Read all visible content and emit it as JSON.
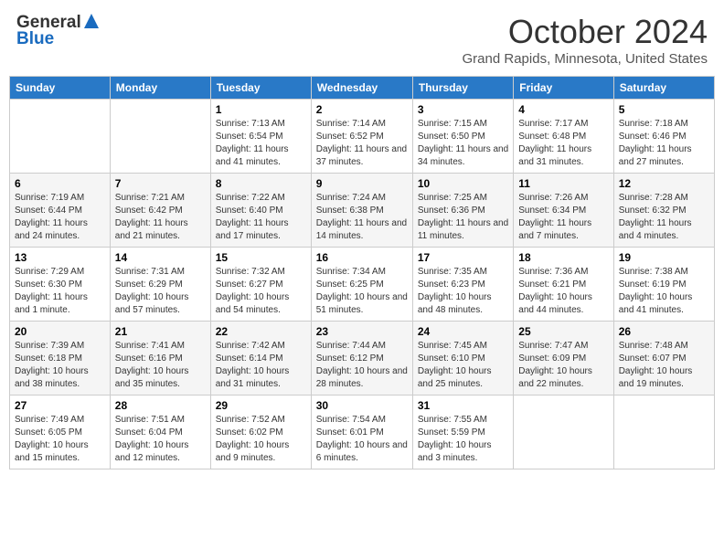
{
  "header": {
    "logo_general": "General",
    "logo_blue": "Blue",
    "title": "October 2024",
    "location": "Grand Rapids, Minnesota, United States"
  },
  "days_of_week": [
    "Sunday",
    "Monday",
    "Tuesday",
    "Wednesday",
    "Thursday",
    "Friday",
    "Saturday"
  ],
  "weeks": [
    [
      {
        "day": "",
        "sunrise": "",
        "sunset": "",
        "daylight": ""
      },
      {
        "day": "",
        "sunrise": "",
        "sunset": "",
        "daylight": ""
      },
      {
        "day": "1",
        "sunrise": "Sunrise: 7:13 AM",
        "sunset": "Sunset: 6:54 PM",
        "daylight": "Daylight: 11 hours and 41 minutes."
      },
      {
        "day": "2",
        "sunrise": "Sunrise: 7:14 AM",
        "sunset": "Sunset: 6:52 PM",
        "daylight": "Daylight: 11 hours and 37 minutes."
      },
      {
        "day": "3",
        "sunrise": "Sunrise: 7:15 AM",
        "sunset": "Sunset: 6:50 PM",
        "daylight": "Daylight: 11 hours and 34 minutes."
      },
      {
        "day": "4",
        "sunrise": "Sunrise: 7:17 AM",
        "sunset": "Sunset: 6:48 PM",
        "daylight": "Daylight: 11 hours and 31 minutes."
      },
      {
        "day": "5",
        "sunrise": "Sunrise: 7:18 AM",
        "sunset": "Sunset: 6:46 PM",
        "daylight": "Daylight: 11 hours and 27 minutes."
      }
    ],
    [
      {
        "day": "6",
        "sunrise": "Sunrise: 7:19 AM",
        "sunset": "Sunset: 6:44 PM",
        "daylight": "Daylight: 11 hours and 24 minutes."
      },
      {
        "day": "7",
        "sunrise": "Sunrise: 7:21 AM",
        "sunset": "Sunset: 6:42 PM",
        "daylight": "Daylight: 11 hours and 21 minutes."
      },
      {
        "day": "8",
        "sunrise": "Sunrise: 7:22 AM",
        "sunset": "Sunset: 6:40 PM",
        "daylight": "Daylight: 11 hours and 17 minutes."
      },
      {
        "day": "9",
        "sunrise": "Sunrise: 7:24 AM",
        "sunset": "Sunset: 6:38 PM",
        "daylight": "Daylight: 11 hours and 14 minutes."
      },
      {
        "day": "10",
        "sunrise": "Sunrise: 7:25 AM",
        "sunset": "Sunset: 6:36 PM",
        "daylight": "Daylight: 11 hours and 11 minutes."
      },
      {
        "day": "11",
        "sunrise": "Sunrise: 7:26 AM",
        "sunset": "Sunset: 6:34 PM",
        "daylight": "Daylight: 11 hours and 7 minutes."
      },
      {
        "day": "12",
        "sunrise": "Sunrise: 7:28 AM",
        "sunset": "Sunset: 6:32 PM",
        "daylight": "Daylight: 11 hours and 4 minutes."
      }
    ],
    [
      {
        "day": "13",
        "sunrise": "Sunrise: 7:29 AM",
        "sunset": "Sunset: 6:30 PM",
        "daylight": "Daylight: 11 hours and 1 minute."
      },
      {
        "day": "14",
        "sunrise": "Sunrise: 7:31 AM",
        "sunset": "Sunset: 6:29 PM",
        "daylight": "Daylight: 10 hours and 57 minutes."
      },
      {
        "day": "15",
        "sunrise": "Sunrise: 7:32 AM",
        "sunset": "Sunset: 6:27 PM",
        "daylight": "Daylight: 10 hours and 54 minutes."
      },
      {
        "day": "16",
        "sunrise": "Sunrise: 7:34 AM",
        "sunset": "Sunset: 6:25 PM",
        "daylight": "Daylight: 10 hours and 51 minutes."
      },
      {
        "day": "17",
        "sunrise": "Sunrise: 7:35 AM",
        "sunset": "Sunset: 6:23 PM",
        "daylight": "Daylight: 10 hours and 48 minutes."
      },
      {
        "day": "18",
        "sunrise": "Sunrise: 7:36 AM",
        "sunset": "Sunset: 6:21 PM",
        "daylight": "Daylight: 10 hours and 44 minutes."
      },
      {
        "day": "19",
        "sunrise": "Sunrise: 7:38 AM",
        "sunset": "Sunset: 6:19 PM",
        "daylight": "Daylight: 10 hours and 41 minutes."
      }
    ],
    [
      {
        "day": "20",
        "sunrise": "Sunrise: 7:39 AM",
        "sunset": "Sunset: 6:18 PM",
        "daylight": "Daylight: 10 hours and 38 minutes."
      },
      {
        "day": "21",
        "sunrise": "Sunrise: 7:41 AM",
        "sunset": "Sunset: 6:16 PM",
        "daylight": "Daylight: 10 hours and 35 minutes."
      },
      {
        "day": "22",
        "sunrise": "Sunrise: 7:42 AM",
        "sunset": "Sunset: 6:14 PM",
        "daylight": "Daylight: 10 hours and 31 minutes."
      },
      {
        "day": "23",
        "sunrise": "Sunrise: 7:44 AM",
        "sunset": "Sunset: 6:12 PM",
        "daylight": "Daylight: 10 hours and 28 minutes."
      },
      {
        "day": "24",
        "sunrise": "Sunrise: 7:45 AM",
        "sunset": "Sunset: 6:10 PM",
        "daylight": "Daylight: 10 hours and 25 minutes."
      },
      {
        "day": "25",
        "sunrise": "Sunrise: 7:47 AM",
        "sunset": "Sunset: 6:09 PM",
        "daylight": "Daylight: 10 hours and 22 minutes."
      },
      {
        "day": "26",
        "sunrise": "Sunrise: 7:48 AM",
        "sunset": "Sunset: 6:07 PM",
        "daylight": "Daylight: 10 hours and 19 minutes."
      }
    ],
    [
      {
        "day": "27",
        "sunrise": "Sunrise: 7:49 AM",
        "sunset": "Sunset: 6:05 PM",
        "daylight": "Daylight: 10 hours and 15 minutes."
      },
      {
        "day": "28",
        "sunrise": "Sunrise: 7:51 AM",
        "sunset": "Sunset: 6:04 PM",
        "daylight": "Daylight: 10 hours and 12 minutes."
      },
      {
        "day": "29",
        "sunrise": "Sunrise: 7:52 AM",
        "sunset": "Sunset: 6:02 PM",
        "daylight": "Daylight: 10 hours and 9 minutes."
      },
      {
        "day": "30",
        "sunrise": "Sunrise: 7:54 AM",
        "sunset": "Sunset: 6:01 PM",
        "daylight": "Daylight: 10 hours and 6 minutes."
      },
      {
        "day": "31",
        "sunrise": "Sunrise: 7:55 AM",
        "sunset": "Sunset: 5:59 PM",
        "daylight": "Daylight: 10 hours and 3 minutes."
      },
      {
        "day": "",
        "sunrise": "",
        "sunset": "",
        "daylight": ""
      },
      {
        "day": "",
        "sunrise": "",
        "sunset": "",
        "daylight": ""
      }
    ]
  ]
}
